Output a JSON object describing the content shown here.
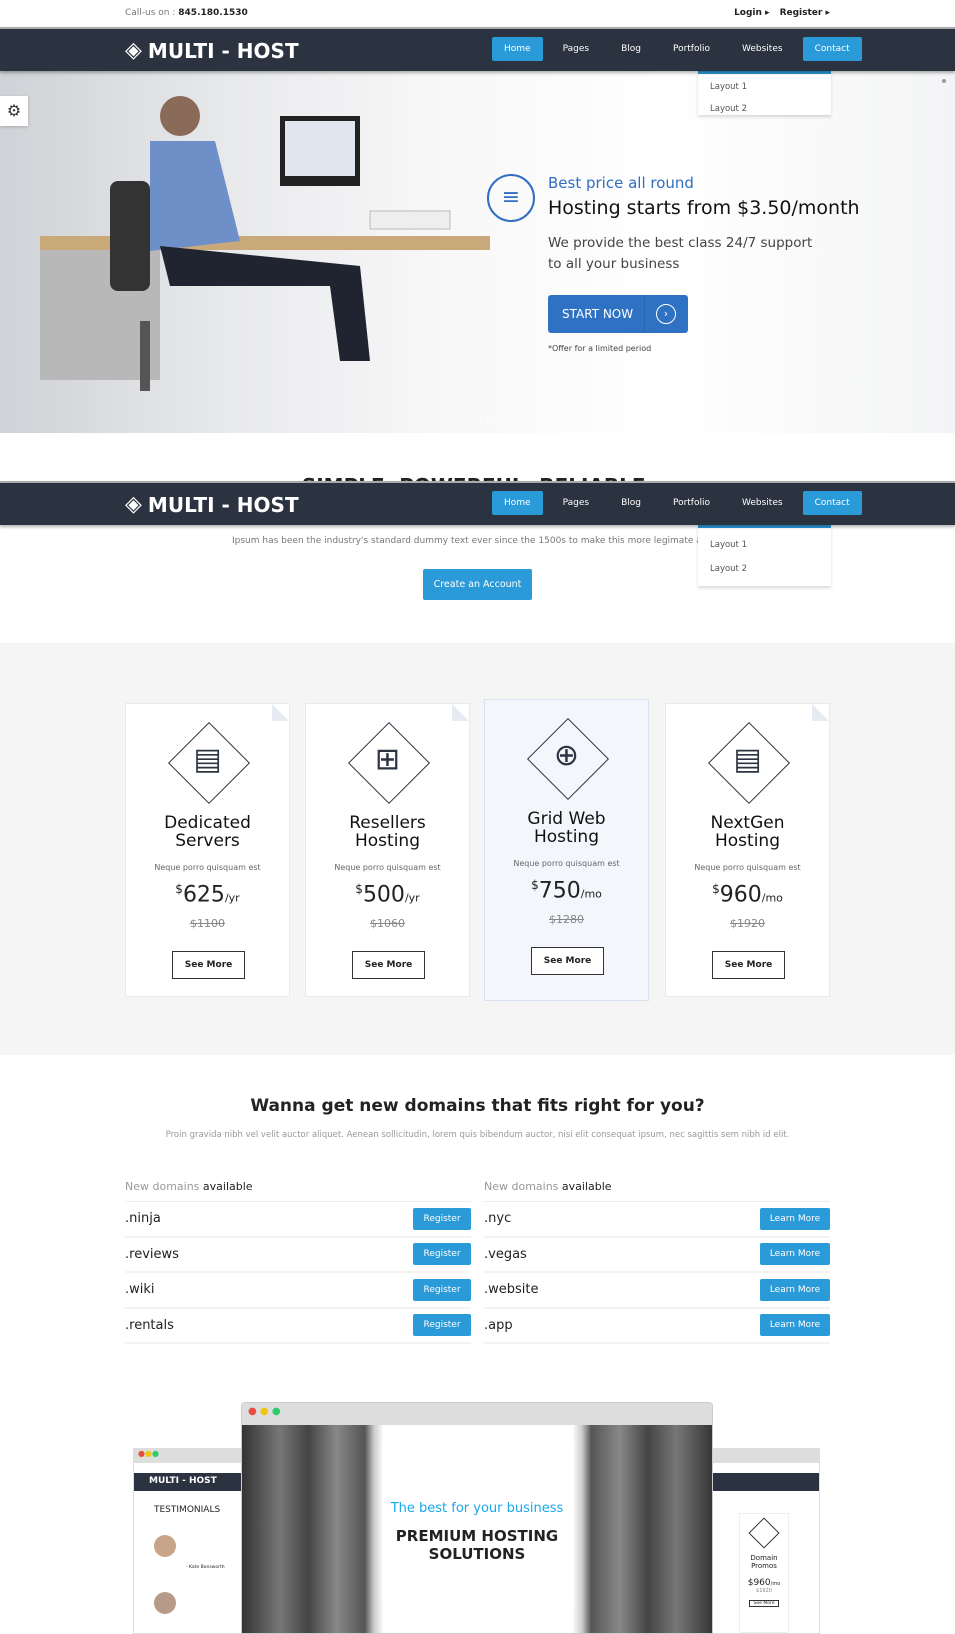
{
  "topbar": {
    "call_label": "Call-us on :",
    "phone": "845.180.1530",
    "login": "Login ▸",
    "register": "Register ▸"
  },
  "nav": {
    "logo": "MULTI - HOST",
    "items": [
      "Home",
      "Pages",
      "Blog",
      "Portfolio",
      "Websites",
      "Contact"
    ],
    "dropdown": [
      "Layout 1",
      "Layout 2"
    ]
  },
  "hero": {
    "kicker": "Best price all round",
    "title": "Hosting starts from $3.50/month",
    "text1": "We provide the best class 24/7 support",
    "text2": "to all your business",
    "cta": "START NOW",
    "note": "*Offer for a limited period"
  },
  "intro": {
    "heading": "SIMPLE. POWERFUL. RELIABLE.",
    "text": "Ipsum has been the industry's standard dummy text ever since the 1500s to make this more legimate at ful",
    "button": "Create an Account"
  },
  "plans": [
    {
      "t1": "Dedicated",
      "t2": "Servers",
      "sub": "Neque porro quisquam est",
      "price": "625",
      "unit": "/yr",
      "old": "$1100",
      "btn": "See More",
      "icon": "server-shield-icon"
    },
    {
      "t1": "Resellers",
      "t2": "Hosting",
      "sub": "Neque porro quisquam est",
      "price": "500",
      "unit": "/yr",
      "old": "$1060",
      "btn": "See More",
      "icon": "linked-servers-icon"
    },
    {
      "t1": "Grid Web",
      "t2": "Hosting",
      "sub": "Neque porro quisquam est",
      "price": "750",
      "unit": "/mo",
      "old": "$1280",
      "btn": "See More",
      "icon": "server-globe-icon"
    },
    {
      "t1": "NextGen",
      "t2": "Hosting",
      "sub": "Neque porro quisquam est",
      "price": "960",
      "unit": "/mo",
      "old": "$1920",
      "btn": "See More",
      "icon": "server-network-icon"
    }
  ],
  "domains": {
    "title": "Wanna get new domains that fits right for you?",
    "text": "Proin gravida nibh vel velit auctor aliquet. Aenean sollicitudin, lorem quis bibendum auctor, nisi elit consequat ipsum, nec sagittis sem nibh id elit.",
    "head_a": "New domains",
    "head_b": "available",
    "left": [
      ".ninja",
      ".reviews",
      ".wiki",
      ".rentals"
    ],
    "left_btn": "Register",
    "right": [
      ".nyc",
      ".vegas",
      ".website",
      ".app"
    ],
    "right_btn": "Learn More"
  },
  "mockup": {
    "kicker": "The best for your business",
    "title1": "PREMIUM HOSTING",
    "title2": "SOLUTIONS",
    "left_logo": "MULTI - HOST",
    "left_heading": "TESTIMONIALS",
    "left_author": "- Kate Bonsworth",
    "right_card_t1": "Domain",
    "right_card_t2": "Promos",
    "right_price": "$960",
    "right_unit": "/mo",
    "right_old": "$1920",
    "right_btn": "See More"
  }
}
